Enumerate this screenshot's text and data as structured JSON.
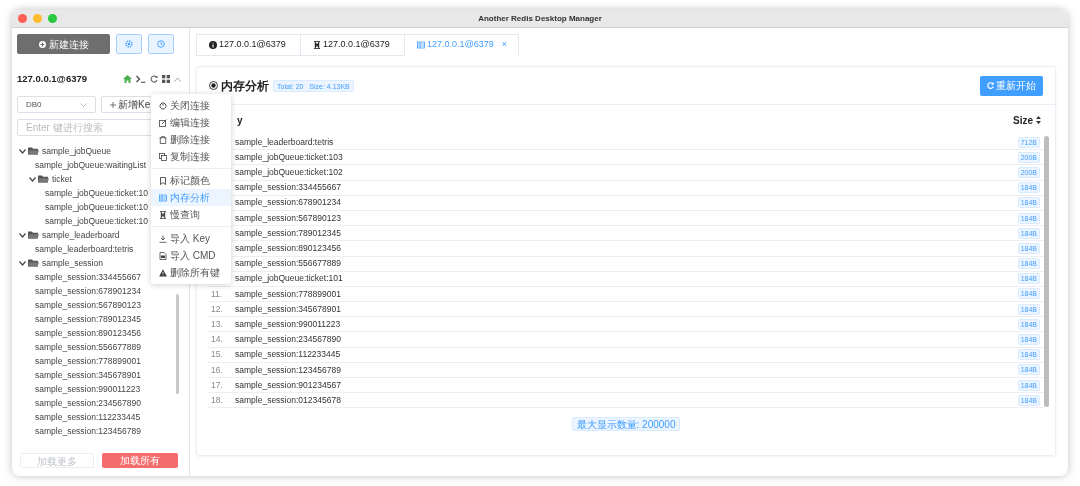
{
  "window": {
    "title": "Another Redis Desktop Manager"
  },
  "sidebar": {
    "new_connection": "新建连接",
    "connection": "127.0.0.1@6379",
    "db_select": "DB0",
    "add_key": "新增Ke",
    "search": {
      "placeholder": "Enter 键进行搜索"
    },
    "tree": [
      {
        "label": "sample_jobQueue",
        "expanded": true,
        "children": [
          {
            "label": "sample_jobQueue:waitingList"
          },
          {
            "label": "ticket",
            "expanded": true,
            "children": [
              {
                "label": "sample_jobQueue:ticket:10"
              },
              {
                "label": "sample_jobQueue:ticket:10"
              },
              {
                "label": "sample_jobQueue:ticket:10"
              }
            ]
          }
        ]
      },
      {
        "label": "sample_leaderboard",
        "expanded": true,
        "children": [
          {
            "label": "sample_leaderboard:tetris"
          }
        ]
      },
      {
        "label": "sample_session",
        "expanded": true,
        "children": [
          {
            "label": "sample_session:334455667"
          },
          {
            "label": "sample_session:678901234"
          },
          {
            "label": "sample_session:567890123"
          },
          {
            "label": "sample_session:789012345"
          },
          {
            "label": "sample_session:890123456"
          },
          {
            "label": "sample_session:556677889"
          },
          {
            "label": "sample_session:778899001"
          },
          {
            "label": "sample_session:345678901"
          },
          {
            "label": "sample_session:990011223"
          },
          {
            "label": "sample_session:234567890"
          },
          {
            "label": "sample_session:112233445"
          },
          {
            "label": "sample_session:123456789"
          }
        ]
      }
    ],
    "load_more": {
      "label": "加载更多",
      "disabled": true
    },
    "load_all": "加载所有"
  },
  "context_menu": {
    "groups": [
      [
        {
          "label": "关闭连接",
          "selected": false
        },
        {
          "label": "编辑连接",
          "selected": false
        },
        {
          "label": "删除连接",
          "selected": false
        },
        {
          "label": "复制连接",
          "selected": false
        }
      ],
      [
        {
          "label": "标记颜色",
          "selected": false
        },
        {
          "label": "内存分析",
          "selected": true
        },
        {
          "label": "慢查询",
          "selected": false
        }
      ],
      [
        {
          "label": "导入 Key",
          "selected": false
        },
        {
          "label": "导入 CMD",
          "selected": false
        },
        {
          "label": "删除所有键",
          "selected": false
        }
      ]
    ]
  },
  "tabs": [
    {
      "label": "127.0.0.1@6379",
      "selected": false
    },
    {
      "label": "127.0.0.1@6379",
      "selected": false
    },
    {
      "label": "127.0.0.1@6379",
      "selected": true,
      "close": "×"
    }
  ],
  "panel": {
    "title": "内存分析",
    "summary": "Total: 20   Size: 4.13KB",
    "restart": "重新开始",
    "columns": [
      "y",
      "Size"
    ],
    "rows": [
      {
        "key": "sample_leaderboard:tetris",
        "size": "712B"
      },
      {
        "key": "sample_jobQueue:ticket:103",
        "size": "200B"
      },
      {
        "key": "sample_jobQueue:ticket:102",
        "size": "200B"
      },
      {
        "key": "sample_session:334455667",
        "size": "184B"
      },
      {
        "key": "sample_session:678901234",
        "size": "184B"
      },
      {
        "key": "sample_session:567890123",
        "size": "184B"
      },
      {
        "key": "sample_session:789012345",
        "size": "184B"
      },
      {
        "key": "sample_session:890123456",
        "size": "184B"
      },
      {
        "key": "sample_session:556677889",
        "size": "184B"
      },
      {
        "key": "sample_jobQueue:ticket:101",
        "size": "184B"
      },
      {
        "index": "11.",
        "key": "sample_session:778899001",
        "size": "184B"
      },
      {
        "index": "12.",
        "key": "sample_session:345678901",
        "size": "184B"
      },
      {
        "index": "13.",
        "key": "sample_session:990011223",
        "size": "184B"
      },
      {
        "index": "14.",
        "key": "sample_session:234567890",
        "size": "184B"
      },
      {
        "index": "15.",
        "key": "sample_session:112233445",
        "size": "184B"
      },
      {
        "index": "16.",
        "key": "sample_session:123456789",
        "size": "184B"
      },
      {
        "index": "17.",
        "key": "sample_session:901234567",
        "size": "184B"
      },
      {
        "index": "18.",
        "key": "sample_session:012345678",
        "size": "184B"
      }
    ],
    "max_display": "最大显示数量: 200000"
  }
}
